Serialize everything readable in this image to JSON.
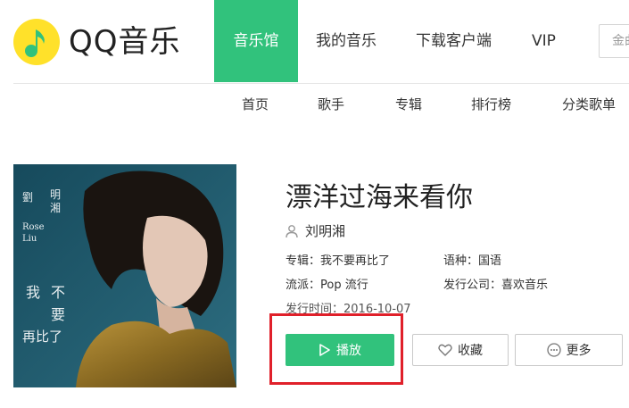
{
  "header": {
    "logo_text": "QQ音乐",
    "nav": [
      "音乐馆",
      "我的音乐",
      "下载客户端",
      "VIP"
    ],
    "active_nav": "音乐馆",
    "search_text": "金曲",
    "accent_color": "#31c27c"
  },
  "subnav": [
    "首页",
    "歌手",
    "专辑",
    "排行榜",
    "分类歌单"
  ],
  "album_cover": {
    "artist_cn_1": "劉",
    "artist_cn_2": "明",
    "artist_cn_3": "湘",
    "artist_en_1": "Rose",
    "artist_en_2": "Liu",
    "album_line_1": "我",
    "album_line_2": "不",
    "album_line_3": "要",
    "album_line_4": "再比了"
  },
  "song": {
    "title": "漂洋过海来看你",
    "singer": "刘明湘",
    "album": "专辑：我不要再比了",
    "language": "语种：国语",
    "genre": "流派：Pop 流行",
    "company": "发行公司：喜欢音乐",
    "release_date": "发行时间：2016-10-07"
  },
  "actions": {
    "play": "播放",
    "favorite": "收藏",
    "more": "更多"
  },
  "icons": {
    "logo": "qq-music-logo-icon",
    "singer": "user-icon",
    "play": "play-icon",
    "favorite": "heart-icon",
    "more": "ellipsis-circle-icon"
  },
  "highlight_color": "#e0202a"
}
